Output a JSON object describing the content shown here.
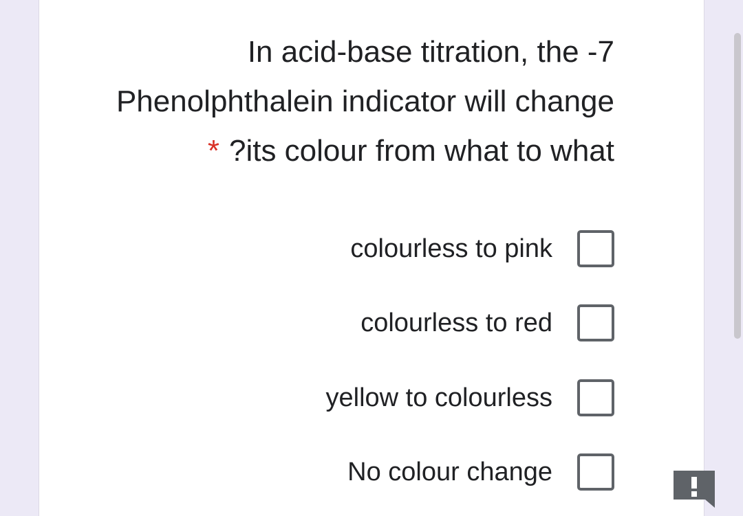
{
  "form": {
    "question": {
      "line1": "In acid-base titration, the -7",
      "line2": "Phenolphthalein indicator will change",
      "line3": "?its colour from what to what",
      "required_marker": "*"
    },
    "options": [
      {
        "label": "colourless to pink",
        "checked": false
      },
      {
        "label": "colourless to red",
        "checked": false
      },
      {
        "label": "yellow to colourless",
        "checked": false
      },
      {
        "label": "No colour change",
        "checked": false
      }
    ]
  },
  "report_button": {
    "icon": "exclamation-icon",
    "glyph": "!"
  },
  "colors": {
    "page_background": "#ece9f6",
    "card_background": "#ffffff",
    "text": "#202124",
    "required": "#d93025",
    "checkbox_border": "#5f6368",
    "report_button": "#5f6368"
  }
}
